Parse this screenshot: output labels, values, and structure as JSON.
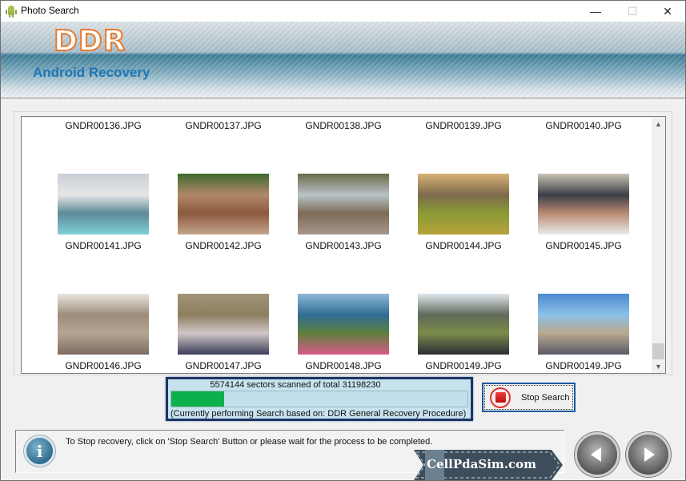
{
  "window": {
    "title": "Photo Search",
    "controls": {
      "minimize": "—",
      "maximize": "☐",
      "close": "✕"
    }
  },
  "banner": {
    "brand": "DDR",
    "product": "Android Recovery"
  },
  "gallery": {
    "files": [
      {
        "name": "GNDR00136.JPG",
        "scene": "not-visible"
      },
      {
        "name": "GNDR00137.JPG",
        "scene": "not-visible"
      },
      {
        "name": "GNDR00138.JPG",
        "scene": "not-visible"
      },
      {
        "name": "GNDR00139.JPG",
        "scene": "not-visible"
      },
      {
        "name": "GNDR00140.JPG",
        "scene": "not-visible"
      },
      {
        "name": "GNDR00141.JPG",
        "scene": "taj-mahal-selfie",
        "colors": [
          "#c9cfd6",
          "#e6e6e6",
          "#5e8a98",
          "#7fd0d8"
        ]
      },
      {
        "name": "GNDR00142.JPG",
        "scene": "temple-ruins",
        "colors": [
          "#3c6a2c",
          "#b3876a",
          "#8c5a3e",
          "#c4a48c"
        ]
      },
      {
        "name": "GNDR00143.JPG",
        "scene": "stone-statues",
        "colors": [
          "#6b6a48",
          "#b9c3c8",
          "#7d6b58",
          "#a8978c"
        ]
      },
      {
        "name": "GNDR00144.JPG",
        "scene": "fort-lawn",
        "colors": [
          "#d9b276",
          "#7d6a4c",
          "#8a9a34",
          "#b8a23c"
        ]
      },
      {
        "name": "GNDR00145.JPG",
        "scene": "tourist-crowd",
        "colors": [
          "#c9c3b3",
          "#3a3f48",
          "#b88a72",
          "#eaeaea"
        ]
      },
      {
        "name": "GNDR00146.JPG",
        "scene": "arc-de-triomphe",
        "colors": [
          "#e8e4df",
          "#9e8c7a",
          "#b5a593",
          "#7d6c60"
        ]
      },
      {
        "name": "GNDR00147.JPG",
        "scene": "group-seated-monument",
        "colors": [
          "#a19478",
          "#8c7e5e",
          "#d0c6c8",
          "#3a3d58"
        ]
      },
      {
        "name": "GNDR00148.JPG",
        "scene": "cliffs-viewers",
        "colors": [
          "#8eb7d8",
          "#2f6c94",
          "#5f7f3c",
          "#d85a8c"
        ]
      },
      {
        "name": "GNDR00149.JPG",
        "scene": "cliffs-group",
        "colors": [
          "#dfe6ec",
          "#5f6a5a",
          "#7a8c4a",
          "#2c2c36"
        ]
      },
      {
        "name": "GNDR00149.JPG",
        "scene": "beach-group",
        "colors": [
          "#4c8ad0",
          "#8cc0e8",
          "#b9a890",
          "#5c5a68"
        ]
      }
    ],
    "scroll_position": 0.97
  },
  "progress": {
    "status": "5574144 sectors scanned of total 31198230",
    "scanned": 5574144,
    "total": 31198230,
    "fraction": 0.1787,
    "note": "(Currently performing Search based on:  DDR General Recovery Procedure)",
    "fill_color": "#0db14b"
  },
  "actions": {
    "stop_search": "Stop Search"
  },
  "info": {
    "icon": "info-icon",
    "message": "To Stop recovery, click on 'Stop Search' Button or please wait for the process to be completed."
  },
  "watermark": {
    "text": "CellPdaSim.com"
  },
  "navigation": {
    "back": "back-arrow-icon",
    "next": "next-arrow-icon"
  }
}
